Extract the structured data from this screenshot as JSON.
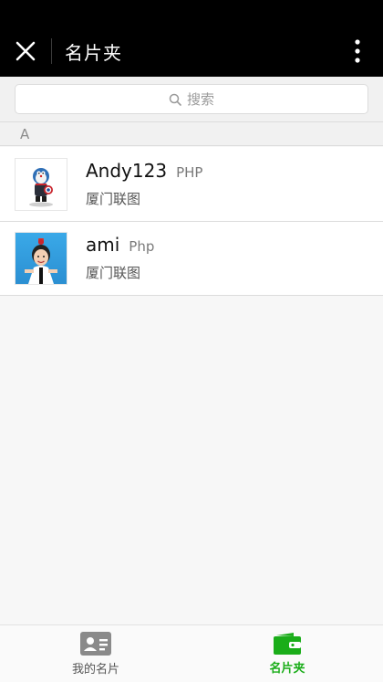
{
  "colors": {
    "nav_background": "#000000",
    "accent_green": "#1aad19",
    "inactive_tab": "#8a8a8a"
  },
  "nav": {
    "title": "名片夹",
    "close_icon": "close-icon",
    "more_icon": "more-vertical-icon"
  },
  "search": {
    "placeholder": "搜索",
    "icon": "search-icon"
  },
  "section": {
    "letter": "A"
  },
  "contacts": [
    {
      "name": "Andy123",
      "title": "PHP",
      "company": "厦门联图",
      "avatar_icon": "robot-avatar"
    },
    {
      "name": "ami",
      "title": "Php",
      "company": "厦门联图",
      "avatar_icon": "child-photo-avatar"
    }
  ],
  "tabs": [
    {
      "label": "我的名片",
      "icon": "id-card-icon",
      "active": false
    },
    {
      "label": "名片夹",
      "icon": "wallet-icon",
      "active": true
    }
  ]
}
